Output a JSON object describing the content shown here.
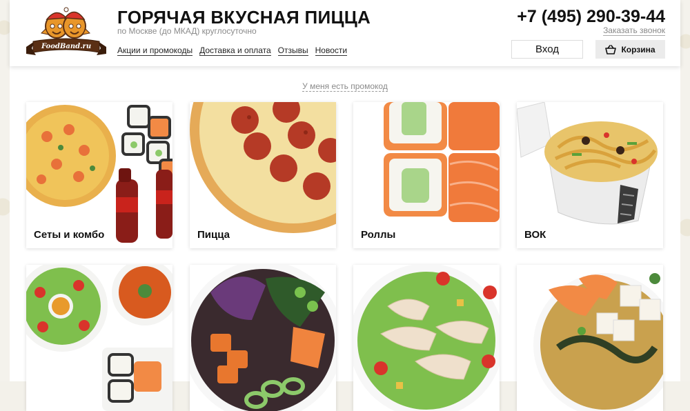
{
  "header": {
    "logo_text": "FoodBand.ru",
    "title": "ГОРЯЧАЯ ВКУСНАЯ ПИЦЦА",
    "subtitle": "по Москве (до МКАД) круглосуточно",
    "menu": [
      {
        "label": "Акции и промокоды"
      },
      {
        "label": "Доставка и оплата"
      },
      {
        "label": "Отзывы"
      },
      {
        "label": "Новости"
      }
    ],
    "phone": "+7 (495) 290-39-44",
    "callback_label": "Заказать звонок",
    "login_label": "Вход",
    "cart_label": "Корзина",
    "cart_icon": "basket-icon"
  },
  "promo_link": "У меня есть промокод",
  "categories": [
    {
      "label": "Сеты и комбо"
    },
    {
      "label": "Пицца"
    },
    {
      "label": "Роллы"
    },
    {
      "label": "ВОК"
    },
    {
      "label": ""
    },
    {
      "label": ""
    },
    {
      "label": ""
    },
    {
      "label": ""
    }
  ],
  "colors": {
    "text": "#111111",
    "muted": "#8a8a8a",
    "logo_brown": "#5a2f14",
    "logo_orange": "#e8962a"
  }
}
